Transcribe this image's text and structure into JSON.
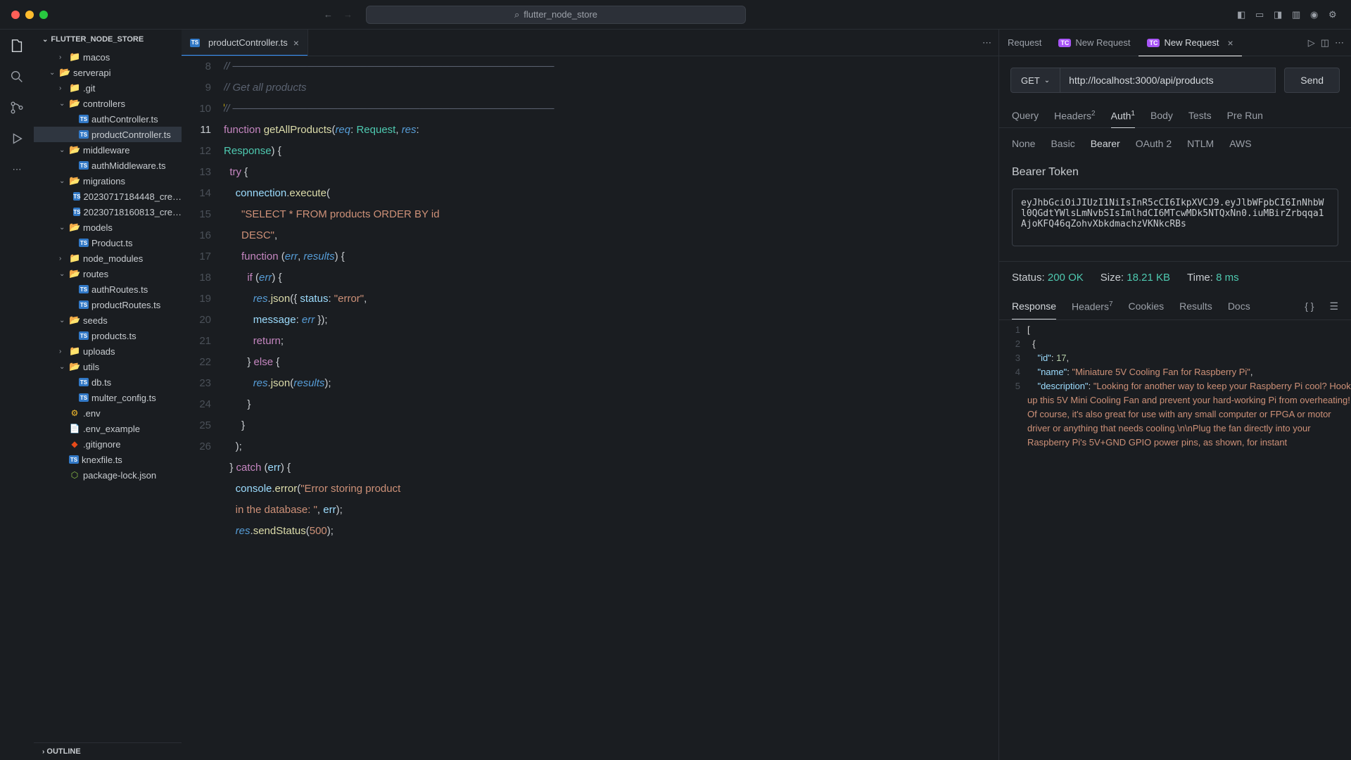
{
  "titlebar": {
    "project": "flutter_node_store"
  },
  "sidebar": {
    "header": "FLUTTER_NODE_STORE",
    "outline": "OUTLINE",
    "tree": [
      {
        "type": "folder",
        "name": "macos",
        "indent": 2,
        "chev": "›",
        "open": false,
        "color": "#a8a8a8"
      },
      {
        "type": "folder",
        "name": "serverapi",
        "indent": 1,
        "chev": "⌄",
        "open": true,
        "color": "#a8a8a8"
      },
      {
        "type": "folder",
        "name": ".git",
        "indent": 2,
        "chev": "›",
        "open": false,
        "color": "#e37933"
      },
      {
        "type": "folder",
        "name": "controllers",
        "indent": 2,
        "chev": "⌄",
        "open": true,
        "color": "#e37933"
      },
      {
        "type": "file",
        "name": "authController.ts",
        "indent": 3,
        "icon": "ts"
      },
      {
        "type": "file",
        "name": "productController.ts",
        "indent": 3,
        "icon": "ts",
        "selected": true
      },
      {
        "type": "folder",
        "name": "middleware",
        "indent": 2,
        "chev": "⌄",
        "open": true,
        "color": "#e37933"
      },
      {
        "type": "file",
        "name": "authMiddleware.ts",
        "indent": 3,
        "icon": "ts"
      },
      {
        "type": "folder",
        "name": "migrations",
        "indent": 2,
        "chev": "⌄",
        "open": true,
        "color": "#e37933"
      },
      {
        "type": "file",
        "name": "20230717184448_cre…",
        "indent": 3,
        "icon": "ts"
      },
      {
        "type": "file",
        "name": "20230718160813_cre…",
        "indent": 3,
        "icon": "ts"
      },
      {
        "type": "folder",
        "name": "models",
        "indent": 2,
        "chev": "⌄",
        "open": true,
        "color": "#e37933"
      },
      {
        "type": "file",
        "name": "Product.ts",
        "indent": 3,
        "icon": "ts"
      },
      {
        "type": "folder",
        "name": "node_modules",
        "indent": 2,
        "chev": "›",
        "open": false,
        "color": "#8dc149"
      },
      {
        "type": "folder",
        "name": "routes",
        "indent": 2,
        "chev": "⌄",
        "open": true,
        "color": "#8dc149"
      },
      {
        "type": "file",
        "name": "authRoutes.ts",
        "indent": 3,
        "icon": "ts"
      },
      {
        "type": "file",
        "name": "productRoutes.ts",
        "indent": 3,
        "icon": "ts"
      },
      {
        "type": "folder",
        "name": "seeds",
        "indent": 2,
        "chev": "⌄",
        "open": true,
        "color": "#e37933"
      },
      {
        "type": "file",
        "name": "products.ts",
        "indent": 3,
        "icon": "ts"
      },
      {
        "type": "folder",
        "name": "uploads",
        "indent": 2,
        "chev": "›",
        "open": false,
        "color": "#e37933"
      },
      {
        "type": "folder",
        "name": "utils",
        "indent": 2,
        "chev": "⌄",
        "open": true,
        "color": "#8dc149"
      },
      {
        "type": "file",
        "name": "db.ts",
        "indent": 3,
        "icon": "ts"
      },
      {
        "type": "file",
        "name": "multer_config.ts",
        "indent": 3,
        "icon": "ts"
      },
      {
        "type": "file",
        "name": ".env",
        "indent": 2,
        "icon": "env",
        "iconColor": "#fbc02d"
      },
      {
        "type": "file",
        "name": ".env_example",
        "indent": 2,
        "icon": "doc"
      },
      {
        "type": "file",
        "name": ".gitignore",
        "indent": 2,
        "icon": "git",
        "iconColor": "#e64a19"
      },
      {
        "type": "file",
        "name": "knexfile.ts",
        "indent": 2,
        "icon": "ts"
      },
      {
        "type": "file",
        "name": "package-lock.json",
        "indent": 2,
        "icon": "npm",
        "iconColor": "#8dc149"
      }
    ]
  },
  "editor": {
    "tab": "productController.ts",
    "lines": [
      "8",
      "9",
      "10",
      "11",
      "12",
      "13",
      "14",
      "15",
      "16",
      "17",
      "18",
      "19",
      "20",
      "21",
      "22",
      "23",
      "24",
      "25",
      "26"
    ],
    "currentLine": "11"
  },
  "api": {
    "tabs": [
      "Request",
      "New Request",
      "New Request"
    ],
    "activeTab": 2,
    "method": "GET",
    "url": "http://localhost:3000/api/products",
    "send": "Send",
    "reqTabs": [
      "Query",
      "Headers",
      "Auth",
      "Body",
      "Tests",
      "Pre Run"
    ],
    "reqBadges": {
      "Headers": "2",
      "Auth": "1"
    },
    "authTypes": [
      "None",
      "Basic",
      "Bearer",
      "OAuth 2",
      "NTLM",
      "AWS"
    ],
    "bearerLabel": "Bearer Token",
    "bearerToken": "eyJhbGciOiJIUzI1NiIsInR5cCI6IkpXVCJ9.eyJlbWFpbCI6InNhbWl0QGdtYWlsLmNvbSIsImlhdCI6MTcwMDk5NTQxNn0.iuMBirZrbqqa1AjoKFQ46qZohvXbkdmachzVKNkcRBs",
    "status": {
      "label": "Status:",
      "value": "200 OK",
      "sizeLabel": "Size:",
      "size": "18.21 KB",
      "timeLabel": "Time:",
      "time": "8 ms"
    },
    "respTabs": [
      "Response",
      "Headers",
      "Cookies",
      "Results",
      "Docs"
    ],
    "respBadge": {
      "Headers": "7"
    },
    "response": {
      "id": 17,
      "name": "Miniature 5V Cooling Fan for Raspberry Pi",
      "description": "Looking for another way to keep your Raspberry Pi cool? Hook up this 5V Mini Cooling Fan and prevent your hard-working Pi from overheating! Of course, it's also great for use with any small computer or FPGA or motor driver or anything that needs cooling.\\n\\nPlug the fan directly into your Raspberry Pi's 5V+GND GPIO power pins, as shown, for instant"
    }
  }
}
